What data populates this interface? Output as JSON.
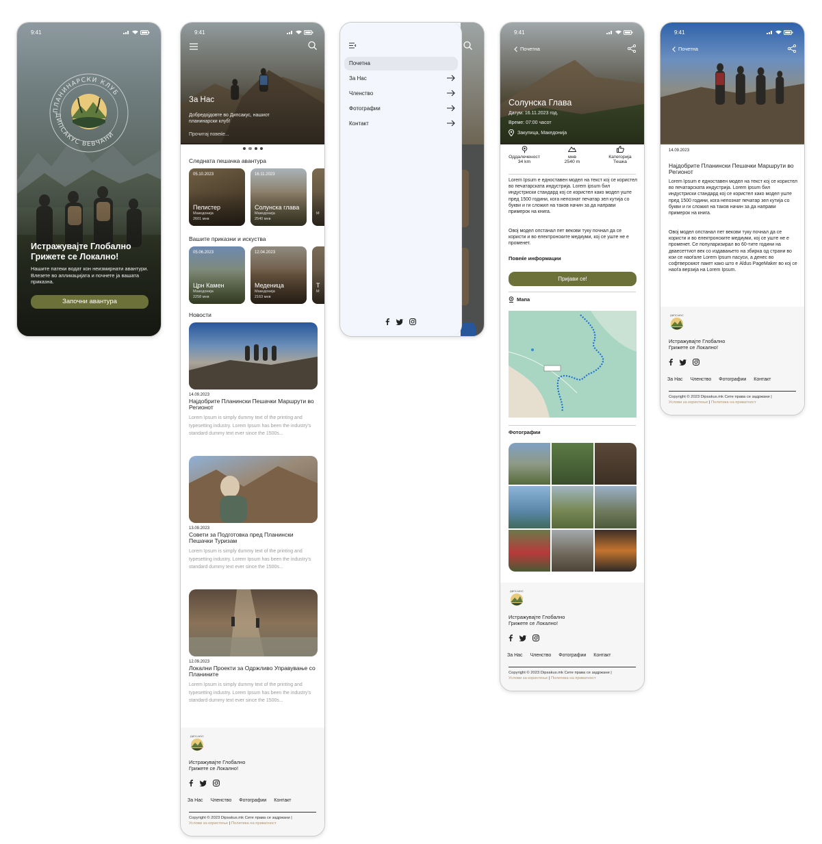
{
  "status": {
    "time": "9:41"
  },
  "colors": {
    "accent": "#6b7139",
    "link": "#b3926a"
  },
  "screen1": {
    "logo_text_top": "ПЛАНИНАРСКИ КЛУБ",
    "logo_text_bottom": "ДИПСАКУС ВЕВЧАНИ",
    "title": "Истражувајте Глобално Грижете се Локално!",
    "text": "Нашите патеки водат кон неизмирнати авантури. Влезете во апликацијата и почнете ја вашата приказна.",
    "button": "Започни авантура"
  },
  "screen2": {
    "hero_title": "За Нас",
    "hero_sub": "Добредојдовте во Дипсакус, нашиот планинарски клуб!",
    "hero_more": "Прочитај повеќе...",
    "section_next": "Следната пешачка авантура",
    "next_cards": [
      {
        "date": "05.10.2023",
        "name": "Пелистер",
        "region": "Македонија",
        "elev": "2601 мнв"
      },
      {
        "date": "16.11.2023",
        "name": "Солунска глава",
        "region": "Македонија",
        "elev": "2540 мнв"
      },
      {
        "date": "",
        "name": "",
        "region": "М",
        "elev": ""
      }
    ],
    "section_stories": "Вашите приказни и искуства",
    "story_cards": [
      {
        "date": "05.06.2023",
        "name": "Црн Камен",
        "region": "Македонија",
        "elev": "2258 мнв"
      },
      {
        "date": "12.04.2023",
        "name": "Меденица",
        "region": "Македонија",
        "elev": "2163 мнв"
      },
      {
        "date": "",
        "name": "Т",
        "region": "М",
        "elev": ""
      }
    ],
    "section_news": "Новости",
    "news": [
      {
        "date": "14.09.2023",
        "title": "Најдобрите Планински Пешачки Маршрути во Регионот",
        "text": "Lorem Ipsum is simply dummy text of the printing and typesetting industry. Lorem Ipsum has been the industry's standard dummy text ever since the 1500s..."
      },
      {
        "date": "13.09.2023",
        "title": "Совети за Подготовка пред Планински Пешачки Туризам",
        "text": "Lorem Ipsum is simply dummy text of the printing and typesetting industry. Lorem Ipsum has been the industry's standard dummy text ever since the 1500s..."
      },
      {
        "date": "12.09.2023",
        "title": "Локални Проекти за Одржливо Управување со Планините",
        "text": "Lorem Ipsum is simply dummy text of the printing and typesetting industry. Lorem Ipsum has been the industry's standard dummy text ever since the 1500s..."
      }
    ]
  },
  "footer": {
    "logo_text": "ДИПСАКУС",
    "tagline_1": "Истражувајте Глобално",
    "tagline_2": "Грижете се Локално!",
    "links": [
      "За Нас",
      "Членство",
      "Фотографии",
      "Контакт"
    ],
    "copyright": "Copyright © 2023 Dipsakus.mk Сите права се задржани |",
    "terms": "Услови за користење",
    "sep": "|",
    "privacy": "Политика на приватност"
  },
  "screen3": {
    "menu": [
      {
        "label": "Почетна",
        "active": true
      },
      {
        "label": "За Нас"
      },
      {
        "label": "Членство"
      },
      {
        "label": "Фотографии"
      },
      {
        "label": "Контакт"
      }
    ]
  },
  "screen4": {
    "back": "Почетна",
    "title": "Солунска Глава",
    "date_label": "Датум:",
    "date": "16.11.2023 год.",
    "time_label": "Време:",
    "time": "07:00 часот",
    "location": "Закупица, Македонија",
    "stats": [
      {
        "icon": "marker-icon",
        "label": "Оддалеченост",
        "value": "34 km"
      },
      {
        "icon": "mountain-icon",
        "label": "мнв",
        "value": "2540 m"
      },
      {
        "icon": "thumb-icon",
        "label": "Категорија",
        "value": "Тешка"
      }
    ],
    "para1": "Lorem Ipsum е едноставен модел на текст кој се користел во печатарската индустрија. Lorem ipsum бил индустриски стандард кој се користел како модел уште пред 1500 години, кога непознат печатар зел кутија со букви и ги сложил на таков начин за да направи примерок на книга.",
    "para2": "Овој модел опстанал пет векови туку почнал да се користи и во електронските медиуми, кој се уште не е променет.",
    "more_info": "Повеќе информации",
    "register": "Пријави се!",
    "map_label": "Мапа",
    "photos_label": "Фотографии"
  },
  "screen5": {
    "back": "Почетна",
    "date": "14.09.2023",
    "title": "Најдобрите Планински Пешачки Маршрути во Регионот",
    "para1": "Lorem Ipsum е едноставен модел на текст кој се користел во печатарската индустрија. Lorem ipsum бил индустриски стандард кој се користел како модел уште пред 1500 години, кога непознат печатар зел кутија со букви и ги сложил на таков начин за да направи примерок на книга.",
    "para2": "Овој модел опстанал пет векови туку почнал да се користи и во електронските медиуми, кој се уште не е променет. Се популаризирал во 60-тите години на дваесеттиот век со издавањето на збирка од страни во кои се наоѓале Lorem Ipsum пасуси, а денес во софтверскиот пакет како што е Aldus PageMaker во кој се наоѓа верзија на Lorem Ipsum."
  }
}
